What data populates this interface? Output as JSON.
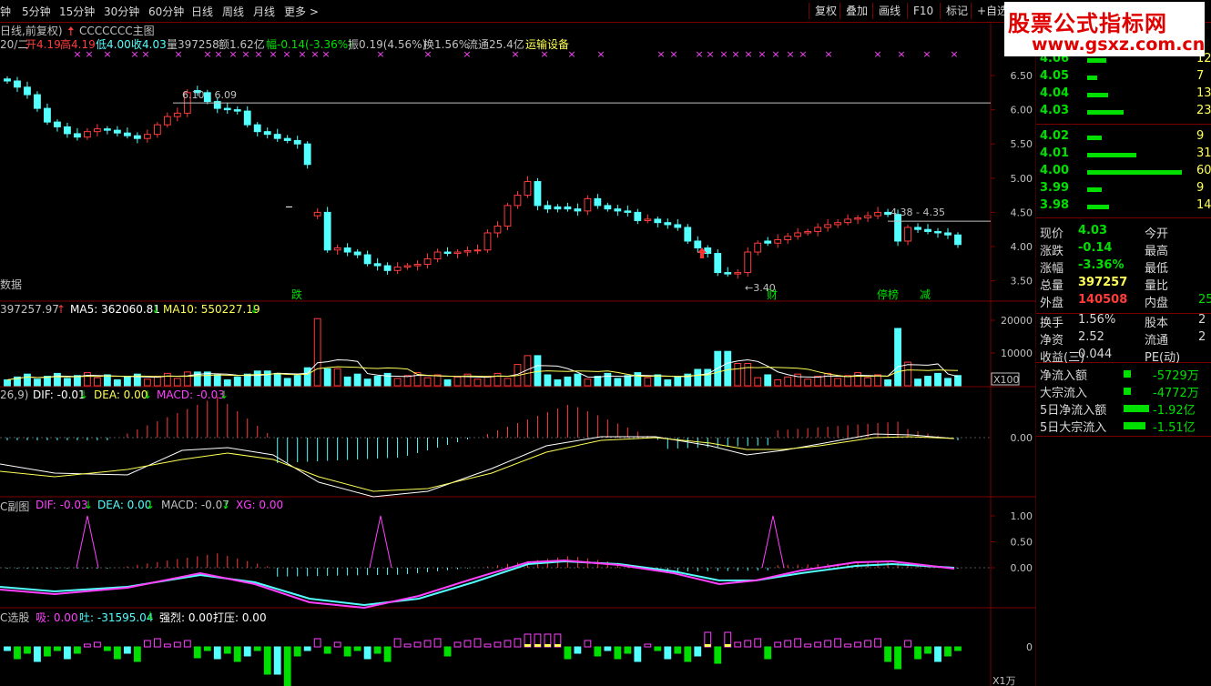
{
  "toolbar": {
    "periods": [
      "钟",
      "5分钟",
      "15分钟",
      "30分钟",
      "60分钟",
      "日线",
      "周线",
      "月线",
      "更多 >"
    ],
    "buttons": [
      "复权",
      "叠加",
      "画线",
      "F10",
      "标记",
      "+自选"
    ]
  },
  "watermark": {
    "title": "股票公式指标网",
    "url": "www.gsxz.com.cn"
  },
  "header": {
    "line1_prefix": "日线,前复权)",
    "formula": "CCCCCCC主图",
    "stats_date": "20/二",
    "open": "开4.19",
    "high": "高4.19",
    "low": "低4.00",
    "close": "收4.03",
    "vol": "量397258",
    "amount": "额1.62亿",
    "change": "幅-0.14(-3.36%)",
    "amplitude": "振0.19(4.56%)",
    "turnover": "换1.56%",
    "float": "流通25.4亿",
    "industry": "运输设备"
  },
  "colors": {
    "up": "#ff3c3c",
    "down": "#54ffff",
    "ma5": "#ffffff",
    "ma10": "#ffff55",
    "magenta": "#ff40ff",
    "green": "#00e000",
    "grid": "#7a0000"
  },
  "price_axis": [
    "6.50",
    "6.00",
    "5.50",
    "5.00",
    "4.50",
    "4.00",
    "3.50"
  ],
  "annotations": {
    "hi": "6.10 - 6.09",
    "mid": "4.38 - 4.35",
    "low": "←3.40",
    "left_note": "数据"
  },
  "event_tags": [
    "跌",
    "财",
    "停榜",
    "减"
  ],
  "vol_panel": {
    "title": "397257.97",
    "ma5": "MA5: 362060.81",
    "ma10": "MA10: 550227.19",
    "axis": [
      "20000",
      "10000"
    ],
    "unit": "X100"
  },
  "macd_panel": {
    "title": "26,9)",
    "dif": "DIF: -0.01",
    "dea": "DEA: 0.00",
    "macd": "MACD: -0.03",
    "axis": [
      "0.00"
    ]
  },
  "sub_panel": {
    "title": "C副图",
    "dif": "DIF: -0.03",
    "dea": "DEA: 0.00",
    "macd": "MACD: -0.07",
    "xg": "XG: 0.00",
    "axis": [
      "1.00",
      "0.50",
      "0.00"
    ]
  },
  "pick_panel": {
    "title": "C选股",
    "xi": "吸: 0.00",
    "tu": "吐: -31595.04",
    "qiang": "强烈: 0.00",
    "daya": "打压: 0.00",
    "axis": [
      "0"
    ],
    "unit": "X1万"
  },
  "order_book": [
    {
      "price": "4.06",
      "vol": "12",
      "frac": 0.2
    },
    {
      "price": "4.05",
      "vol": "7",
      "frac": 0.11
    },
    {
      "price": "4.04",
      "vol": "13",
      "frac": 0.22
    },
    {
      "price": "4.03",
      "vol": "23",
      "frac": 0.38
    },
    {
      "price": "4.02",
      "vol": "9",
      "frac": 0.15
    },
    {
      "price": "4.01",
      "vol": "31",
      "frac": 0.52
    },
    {
      "price": "4.00",
      "vol": "60",
      "frac": 1.0
    },
    {
      "price": "3.99",
      "vol": "9",
      "frac": 0.15
    },
    {
      "price": "3.98",
      "vol": "14",
      "frac": 0.23
    }
  ],
  "quote": [
    {
      "k": "现价",
      "v": "4.03",
      "k2": "今开",
      "c": "#00e000"
    },
    {
      "k": "涨跌",
      "v": "-0.14",
      "k2": "最高",
      "c": "#00e000"
    },
    {
      "k": "涨幅",
      "v": "-3.36%",
      "k2": "最低",
      "c": "#00e000"
    },
    {
      "k": "总量",
      "v": "397257",
      "k2": "量比",
      "c": "#ffff55"
    },
    {
      "k": "外盘",
      "v": "140508",
      "k2": "内盘",
      "v2": "25",
      "c": "#ff3c3c"
    }
  ],
  "quote2": [
    {
      "k": "换手",
      "v": "1.56%",
      "k2": "股本",
      "v2": "2"
    },
    {
      "k": "净资",
      "v": "2.52",
      "k2": "流通",
      "v2": "2"
    },
    {
      "k": "收益(三)",
      "v": "0.044",
      "k2": "PE(动)",
      "v2": ""
    }
  ],
  "flow": [
    {
      "k": "净流入额",
      "v": "-5729万",
      "bar": 8
    },
    {
      "k": "大宗流入",
      "v": "-4772万",
      "bar": 8
    },
    {
      "k": "5日净流入额",
      "v": "-1.92亿",
      "bar": 28
    },
    {
      "k": "5日大宗流入",
      "v": "-1.51亿",
      "bar": 24
    }
  ]
}
